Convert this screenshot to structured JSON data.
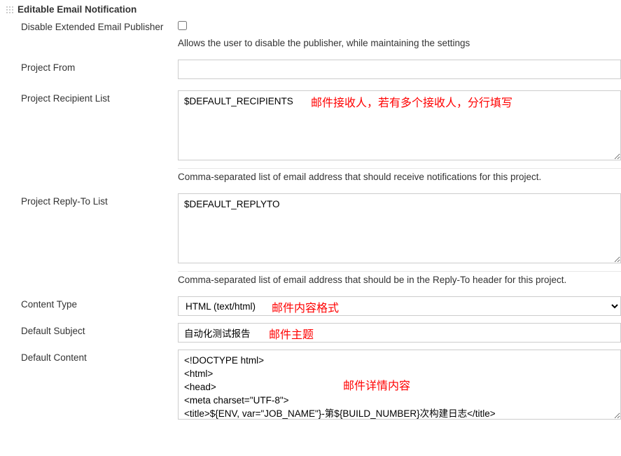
{
  "section": {
    "title": "Editable Email Notification"
  },
  "fields": {
    "disablePublisher": {
      "label": "Disable Extended Email Publisher",
      "help": "Allows the user to disable the publisher, while maintaining the settings"
    },
    "projectFrom": {
      "label": "Project From",
      "value": ""
    },
    "recipientList": {
      "label": "Project Recipient List",
      "value": "$DEFAULT_RECIPIENTS",
      "help": "Comma-separated list of email address that should receive notifications for this project."
    },
    "replyToList": {
      "label": "Project Reply-To List",
      "value": "$DEFAULT_REPLYTO",
      "help": "Comma-separated list of email address that should be in the Reply-To header for this project."
    },
    "contentType": {
      "label": "Content Type",
      "value": "HTML (text/html)"
    },
    "defaultSubject": {
      "label": "Default Subject",
      "value": "自动化测试报告"
    },
    "defaultContent": {
      "label": "Default Content",
      "value": "<!DOCTYPE html>\n<html>\n<head>\n<meta charset=\"UTF-8\">\n<title>${ENV, var=\"JOB_NAME\"}-第${BUILD_NUMBER}次构建日志</title>"
    }
  },
  "annotations": {
    "recipient": "邮件接收人，若有多个接收人，分行填写",
    "contentType": "邮件内容格式",
    "subject": "邮件主题",
    "content": "邮件详情内容"
  }
}
